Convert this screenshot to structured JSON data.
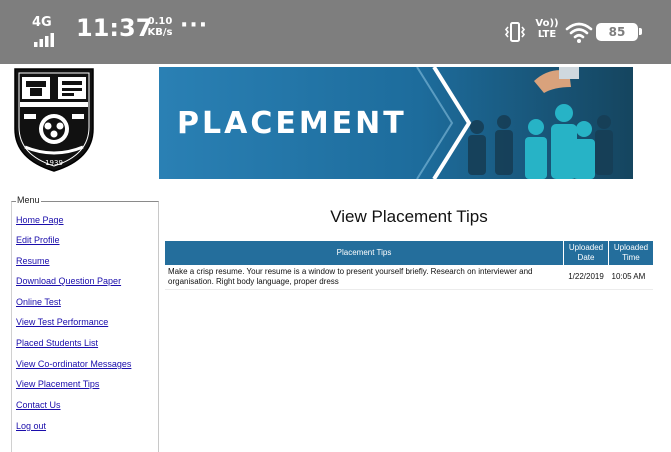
{
  "status_bar": {
    "network": "4G",
    "time": "11:37",
    "speed_value": "0.10",
    "speed_unit": "KB/s",
    "more": "···",
    "volte_top": "Vo))",
    "volte_bottom": "LTE",
    "battery": "85"
  },
  "logo": {
    "year": "1939"
  },
  "banner": {
    "title": "PLACEMENT"
  },
  "menu": {
    "legend": "Menu",
    "items": [
      {
        "label": "Home Page"
      },
      {
        "label": "Edit Profile"
      },
      {
        "label": "Resume"
      },
      {
        "label": "Download Question Paper"
      },
      {
        "label": "Online Test"
      },
      {
        "label": "View Test Performance"
      },
      {
        "label": "Placed Students List"
      },
      {
        "label": "View Co-ordinator Messages"
      },
      {
        "label": "View Placement Tips"
      },
      {
        "label": "Contact Us"
      },
      {
        "label": "Log out"
      }
    ]
  },
  "main": {
    "heading": "View Placement Tips",
    "table": {
      "headers": [
        "Placement Tips",
        "Uploaded Date",
        "Uploaded Time"
      ],
      "rows": [
        {
          "tip": "Make a crisp resume. Your resume is a window to present yourself briefly. Research on interviewer and organisation. Right body language, proper dress",
          "date": "1/22/2019",
          "time": "10:05 AM"
        }
      ]
    }
  },
  "colors": {
    "status_bar": "#7e7e7e",
    "table_header": "#246e9c",
    "banner_bg": "#1f6d9b",
    "link": "#1a0dab"
  }
}
